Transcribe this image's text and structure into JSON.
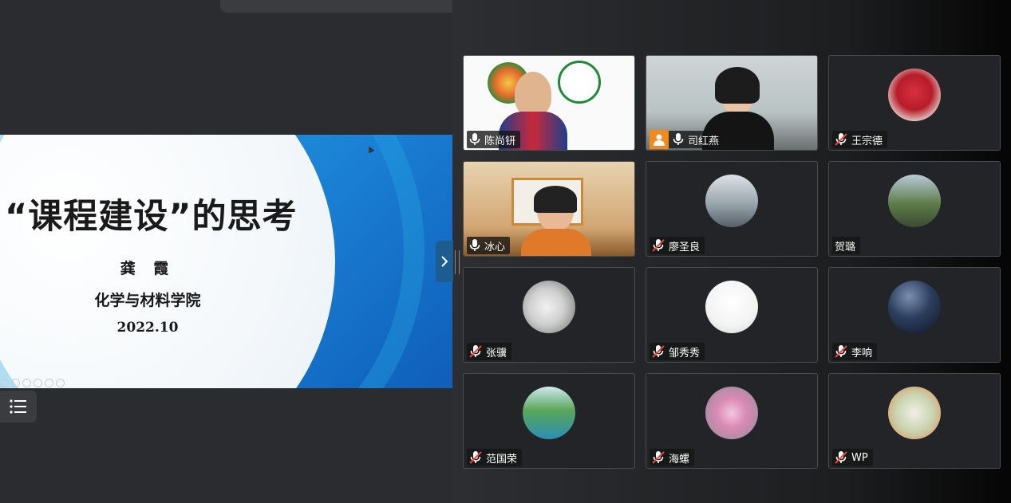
{
  "slide": {
    "title": "“课程建设”的思考",
    "author": "龚 霞",
    "school": "化学与材料学院",
    "date": "2022.10"
  },
  "participants": [
    {
      "name": "陈尚钘",
      "mic": "on",
      "media": "video"
    },
    {
      "name": "司红燕",
      "mic": "on",
      "media": "video",
      "host_badge": true
    },
    {
      "name": "王宗德",
      "mic": "muted",
      "media": "avatar"
    },
    {
      "name": "冰心",
      "mic": "on",
      "media": "video"
    },
    {
      "name": "廖圣良",
      "mic": "muted",
      "media": "avatar"
    },
    {
      "name": "贺璐",
      "mic": "none",
      "media": "avatar"
    },
    {
      "name": "张骥",
      "mic": "muted",
      "media": "avatar"
    },
    {
      "name": "邹秀秀",
      "mic": "muted",
      "media": "avatar"
    },
    {
      "name": "李响",
      "mic": "muted",
      "media": "avatar"
    },
    {
      "name": "范国荣",
      "mic": "muted",
      "media": "avatar"
    },
    {
      "name": "海螺",
      "mic": "muted",
      "media": "avatar"
    },
    {
      "name": "WP",
      "mic": "muted",
      "media": "avatar"
    }
  ],
  "colors": {
    "accent_blue": "#1a7fd3",
    "host_orange": "#f08a1c",
    "tile_bg": "#232427"
  }
}
